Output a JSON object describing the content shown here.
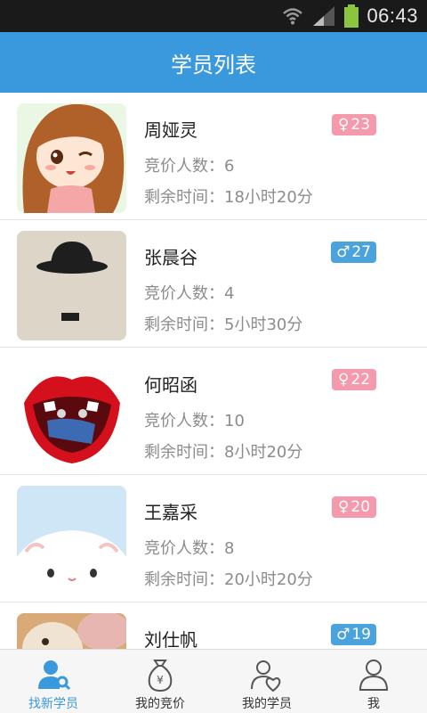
{
  "status_bar": {
    "time": "06:43",
    "icons": [
      "wifi-icon",
      "signal-icon",
      "battery-icon"
    ]
  },
  "header": {
    "title": "学员列表"
  },
  "students": [
    {
      "name": "周娅灵",
      "gender_symbol": "♀",
      "gender": "female",
      "age": "23",
      "bid_line": "竞价人数：6",
      "time_line": "剩余时间：18小时20分",
      "avatar": "cartoon-girl-avatar"
    },
    {
      "name": "张晨谷",
      "gender_symbol": "♂",
      "gender": "male",
      "age": "27",
      "bid_line": "竞价人数：4",
      "time_line": "剩余时间：5小时30分",
      "avatar": "bowler-hat-avatar"
    },
    {
      "name": "何昭函",
      "gender_symbol": "♀",
      "gender": "female",
      "age": "22",
      "bid_line": "竞价人数：10",
      "time_line": "剩余时间：8小时20分",
      "avatar": "red-lips-avatar"
    },
    {
      "name": "王嘉采",
      "gender_symbol": "♀",
      "gender": "female",
      "age": "20",
      "bid_line": "竞价人数：8",
      "time_line": "剩余时间：20小时20分",
      "avatar": "white-hamster-avatar"
    },
    {
      "name": "刘仕帆",
      "gender_symbol": "♂",
      "gender": "male",
      "age": "19",
      "bid_line": "",
      "time_line": "",
      "avatar": "cat-photo-avatar"
    }
  ],
  "tabs": [
    {
      "label": "找新学员",
      "icon": "find-student-icon",
      "active": true
    },
    {
      "label": "我的竞价",
      "icon": "money-bag-icon",
      "active": false
    },
    {
      "label": "我的学员",
      "icon": "my-students-icon",
      "active": false
    },
    {
      "label": "我",
      "icon": "person-icon",
      "active": false
    }
  ],
  "colors": {
    "header": "#3a98dc",
    "female_badge": "#f59aad",
    "male_badge": "#4aa3dc",
    "active_tab": "#3a98dc"
  }
}
